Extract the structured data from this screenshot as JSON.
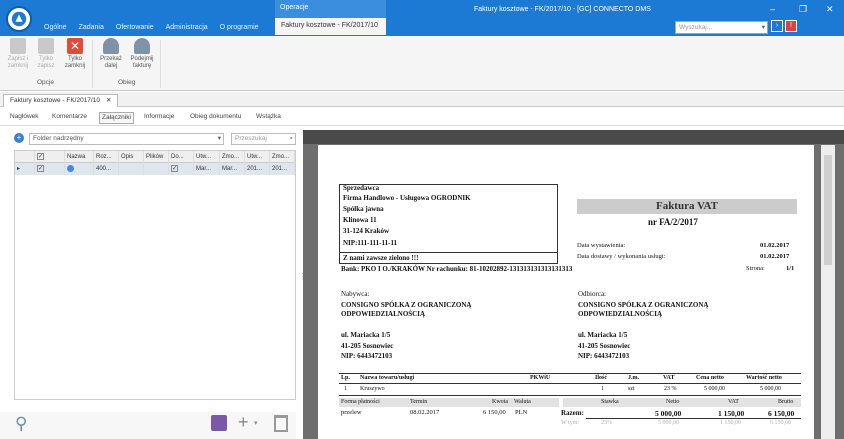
{
  "app": {
    "window_title": "Faktury kosztowe - FK/2017/10 - [GC] CONNECTO DMS",
    "context_group": "Operacje",
    "menu_tabs": [
      "Ogólne",
      "Zadania",
      "Ofertowanie",
      "Administracja",
      "O programie"
    ],
    "active_tab": "Faktury kosztowe - FK/2017/10",
    "search_placeholder": "Wyszukaj..."
  },
  "ribbon": {
    "buttons": [
      {
        "label": "Zapisz i zamknij",
        "icon": "save-close-icon",
        "enabled": false
      },
      {
        "label": "Tylko zapisz",
        "icon": "save-icon",
        "enabled": false
      },
      {
        "label": "Tylko zamknij",
        "icon": "close-icon",
        "enabled": true
      },
      {
        "label": "Przekaż dalej",
        "icon": "forward-user-icon",
        "enabled": true
      },
      {
        "label": "Podejmij fakturę",
        "icon": "take-invoice-icon",
        "enabled": true
      }
    ],
    "groups": [
      "Opcje",
      "Obieg"
    ]
  },
  "doc_tab": "Faktury kosztowe - FK/2017/10",
  "sub_tabs": [
    "Nagłówek",
    "Komentarze",
    "Załączniki",
    "Informacje",
    "Obieg dokumentu",
    "Wstążka"
  ],
  "attachments": {
    "folder_placeholder": "Folder nadrzędny",
    "search_placeholder": "Przeszukaj",
    "columns": [
      "",
      "",
      "Nazwa",
      "Roz...",
      "Opis",
      "Plików",
      "Do...",
      "Utw...",
      "Zmo...",
      "Utw...",
      "Zmo..."
    ],
    "row": [
      "",
      "",
      "",
      "400...",
      "",
      "",
      "",
      "Mar...",
      "Mar...",
      "201...",
      "201..."
    ]
  },
  "invoice": {
    "seller_label": "Sprzedawca",
    "seller_lines": [
      "Firma Handlowo - Usługowa OGRODNIK",
      "Spółka jawna",
      "Klinowa 11",
      "31-124 Kraków",
      "NIP:111-111-11-11"
    ],
    "slogan": "Z nami zawsze zielono !!!",
    "bank": "Bank: PKO I O./KRAKÓW   Nr rachunku: 81-10202892-131313131313131313",
    "title": "Faktura VAT",
    "number": "nr FA/2/2017",
    "date_issue_label": "Data wystawienia:",
    "date_issue": "01.02.2017",
    "date_delivery_label": "Data dostawy / wykonania usługi:",
    "date_delivery": "01.02.2017",
    "page_label": "Strona:",
    "page": "1/1",
    "buyer_label": "Nabywca:",
    "buyer_lines": [
      "CONSIGNO SPÓŁKA Z OGRANICZONĄ",
      "ODPOWIEDZIALNOŚCIĄ",
      "",
      "ul. Mariacka 1/5",
      "41-205 Sosnowiec",
      "NIP: 6443472103"
    ],
    "recipient_label": "Odbiorca:",
    "recipient_lines": [
      "CONSIGNO SPÓŁKA Z OGRANICZONĄ",
      "ODPOWIEDZIALNOŚCIĄ",
      "",
      "ul. Mariacka 1/5",
      "41-205 Sosnowiec",
      "NIP: 6443472103"
    ],
    "table_headers": [
      "Lp.",
      "Nazwa towaru/usługi",
      "PKWiU",
      "Ilość",
      "J.m.",
      "VAT",
      "Cena netto",
      "Wartość netto"
    ],
    "item": [
      "1",
      "Kruszywo",
      "",
      "1",
      "szt",
      "23 %",
      "5 000,00",
      "5 000,00"
    ],
    "pay_headers": [
      "Forma płatności",
      "Termin",
      "Kwota",
      "Waluta",
      "Stawka",
      "Netto",
      "VAT",
      "Brutto"
    ],
    "pay_row": [
      "przelew",
      "08.02.2017",
      "6 150,00",
      "PLN"
    ],
    "total_label": "Razem:",
    "total": [
      "5 000,00",
      "1 150,00",
      "6 150,00"
    ],
    "cut_row_label": "W tym:",
    "cut_row": [
      "23%",
      "5 000,00",
      "1 150,00",
      "6 150,00"
    ]
  }
}
